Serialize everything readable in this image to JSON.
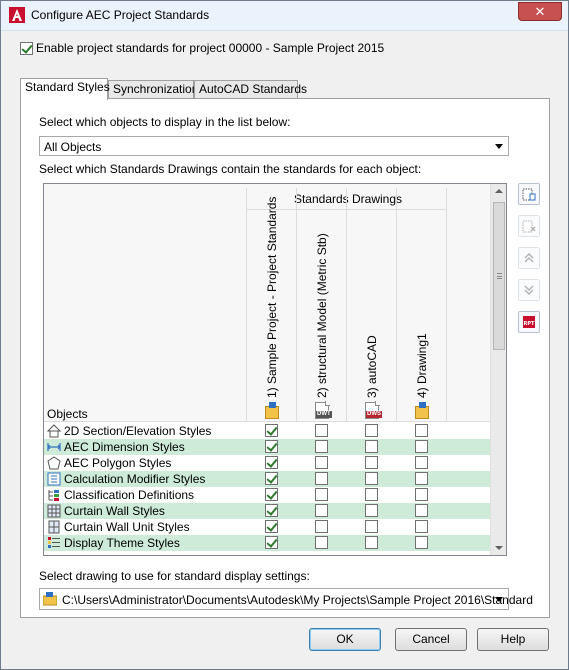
{
  "window": {
    "title": "Configure AEC Project Standards",
    "close_label": "✕"
  },
  "enable": {
    "checked": true,
    "label": "Enable project standards for project 00000 - Sample Project 2015"
  },
  "tabs": [
    {
      "label": "Standard Styles",
      "active": true
    },
    {
      "label": "Synchronization",
      "active": false
    },
    {
      "label": "AutoCAD Standards",
      "active": false
    }
  ],
  "objects_select": {
    "prompt": "Select which objects to display in the list below:",
    "value": "All Objects"
  },
  "standards_prompt": "Select which Standards Drawings contain the standards for each object:",
  "grid": {
    "group_header": "Standards Drawings",
    "objects_header": "Objects",
    "columns": [
      {
        "label": "1) Sample Project - Project Standards",
        "icon": "project-folder-icon"
      },
      {
        "label": "2) structural Model (Metric Stb)",
        "icon": "dwt-file-icon"
      },
      {
        "label": "3) autoCAD",
        "icon": "dws-file-icon"
      },
      {
        "label": "4) Drawing1",
        "icon": "drawing-folder-icon"
      }
    ],
    "rows": [
      {
        "label": "2D Section/Elevation Styles",
        "icon": "section-elevation-icon",
        "checks": [
          true,
          false,
          false,
          false
        ]
      },
      {
        "label": "AEC Dimension Styles",
        "icon": "dimension-icon",
        "checks": [
          true,
          false,
          false,
          false
        ]
      },
      {
        "label": "AEC Polygon Styles",
        "icon": "polygon-icon",
        "checks": [
          true,
          false,
          false,
          false
        ]
      },
      {
        "label": "Calculation Modifier Styles",
        "icon": "calculation-modifier-icon",
        "checks": [
          true,
          false,
          false,
          false
        ]
      },
      {
        "label": "Classification Definitions",
        "icon": "classification-icon",
        "checks": [
          true,
          false,
          false,
          false
        ]
      },
      {
        "label": "Curtain Wall Styles",
        "icon": "curtain-wall-icon",
        "checks": [
          true,
          false,
          false,
          false
        ]
      },
      {
        "label": "Curtain Wall Unit Styles",
        "icon": "curtain-wall-unit-icon",
        "checks": [
          true,
          false,
          false,
          false
        ]
      },
      {
        "label": "Display Theme Styles",
        "icon": "display-theme-icon",
        "checks": [
          true,
          false,
          false,
          false
        ]
      }
    ]
  },
  "side_buttons": [
    {
      "name": "add-drawing-button",
      "icon": "add-drawing-icon",
      "enabled": true
    },
    {
      "name": "remove-drawing-button",
      "icon": "remove-drawing-icon",
      "enabled": false
    },
    {
      "name": "move-up-button",
      "icon": "move-up-icon",
      "enabled": false
    },
    {
      "name": "move-down-button",
      "icon": "move-down-icon",
      "enabled": false
    },
    {
      "name": "pdf-report-button",
      "icon": "rpt-icon",
      "enabled": true,
      "tag": "RPT"
    }
  ],
  "display_settings": {
    "prompt": "Select drawing to use for standard display settings:",
    "value": "C:\\Users\\Administrator\\Documents\\Autodesk\\My Projects\\Sample Project 2016\\Standard"
  },
  "buttons": {
    "ok": "OK",
    "cancel": "Cancel",
    "help": "Help"
  },
  "colors": {
    "row_highlight": "#cdebd8",
    "accent": "#3c7fb1"
  }
}
